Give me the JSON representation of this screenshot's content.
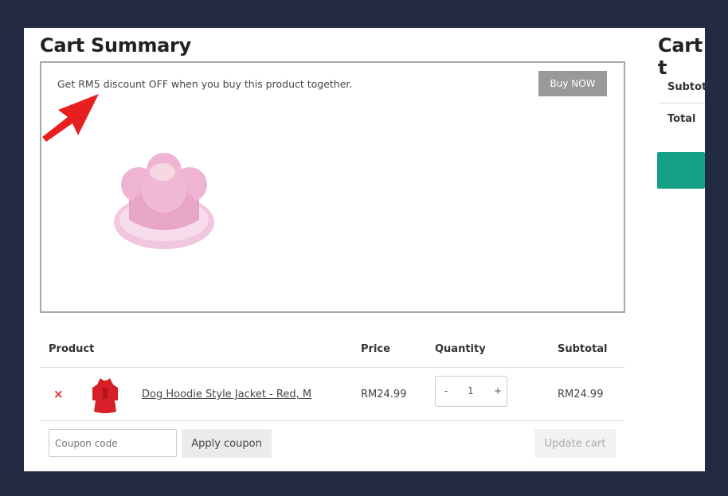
{
  "page": {
    "title": "Cart Summary",
    "side_title": "Cart t"
  },
  "promo": {
    "text": "Get RM5 discount OFF when you buy this product together.",
    "button_label": "Buy NOW"
  },
  "table": {
    "headers": {
      "product": "Product",
      "price": "Price",
      "quantity": "Quantity",
      "subtotal": "Subtotal"
    },
    "rows": [
      {
        "remove": "×",
        "name": "Dog Hoodie Style Jacket - Red, M",
        "price": "RM24.99",
        "qty": "1",
        "minus": "-",
        "plus": "+",
        "subtotal": "RM24.99"
      }
    ]
  },
  "actions": {
    "coupon_placeholder": "Coupon code",
    "apply_label": "Apply coupon",
    "update_label": "Update cart"
  },
  "totals": {
    "subtotal_label": "Subtota",
    "total_label": "Total"
  },
  "colors": {
    "background": "#222b43",
    "checkout": "#16a085",
    "remove": "#e2262b",
    "arrow": "#e62020"
  }
}
